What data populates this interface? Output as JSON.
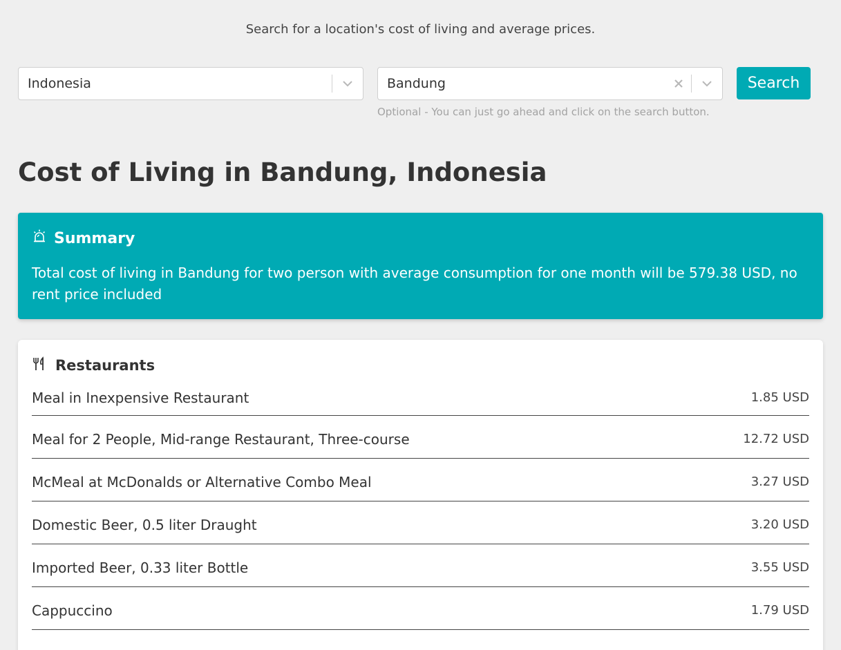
{
  "intro_text": "Search for a location's cost of living and average prices.",
  "country_select": {
    "value": "Indonesia"
  },
  "city_select": {
    "value": "Bandung",
    "hint": "Optional - You can just go ahead and click on the search button."
  },
  "search_button": {
    "label": "Search"
  },
  "page_title": "Cost of Living in Bandung, Indonesia",
  "summary": {
    "title": "Summary",
    "text": "Total cost of living in Bandung for two person with average consumption for one month will be 579.38 USD, no rent price included"
  },
  "restaurants": {
    "title": "Restaurants",
    "items": [
      {
        "name": "Meal in Inexpensive Restaurant",
        "price": "1.85 USD"
      },
      {
        "name": "Meal for 2 People, Mid-range Restaurant, Three-course",
        "price": "12.72 USD"
      },
      {
        "name": "McMeal at McDonalds or Alternative Combo Meal",
        "price": "3.27 USD"
      },
      {
        "name": "Domestic Beer, 0.5 liter Draught",
        "price": "3.20 USD"
      },
      {
        "name": "Imported Beer, 0.33 liter Bottle",
        "price": "3.55 USD"
      },
      {
        "name": "Cappuccino",
        "price": "1.79 USD"
      }
    ]
  },
  "icons": {
    "summary": "alarm-icon",
    "restaurants": "fork-knife-icon",
    "dropdown": "chevron-down-icon",
    "clear": "close-icon"
  },
  "colors": {
    "accent": "#00aab4",
    "background": "#efefef",
    "card": "#ffffff",
    "hint": "#a3a3a3"
  }
}
